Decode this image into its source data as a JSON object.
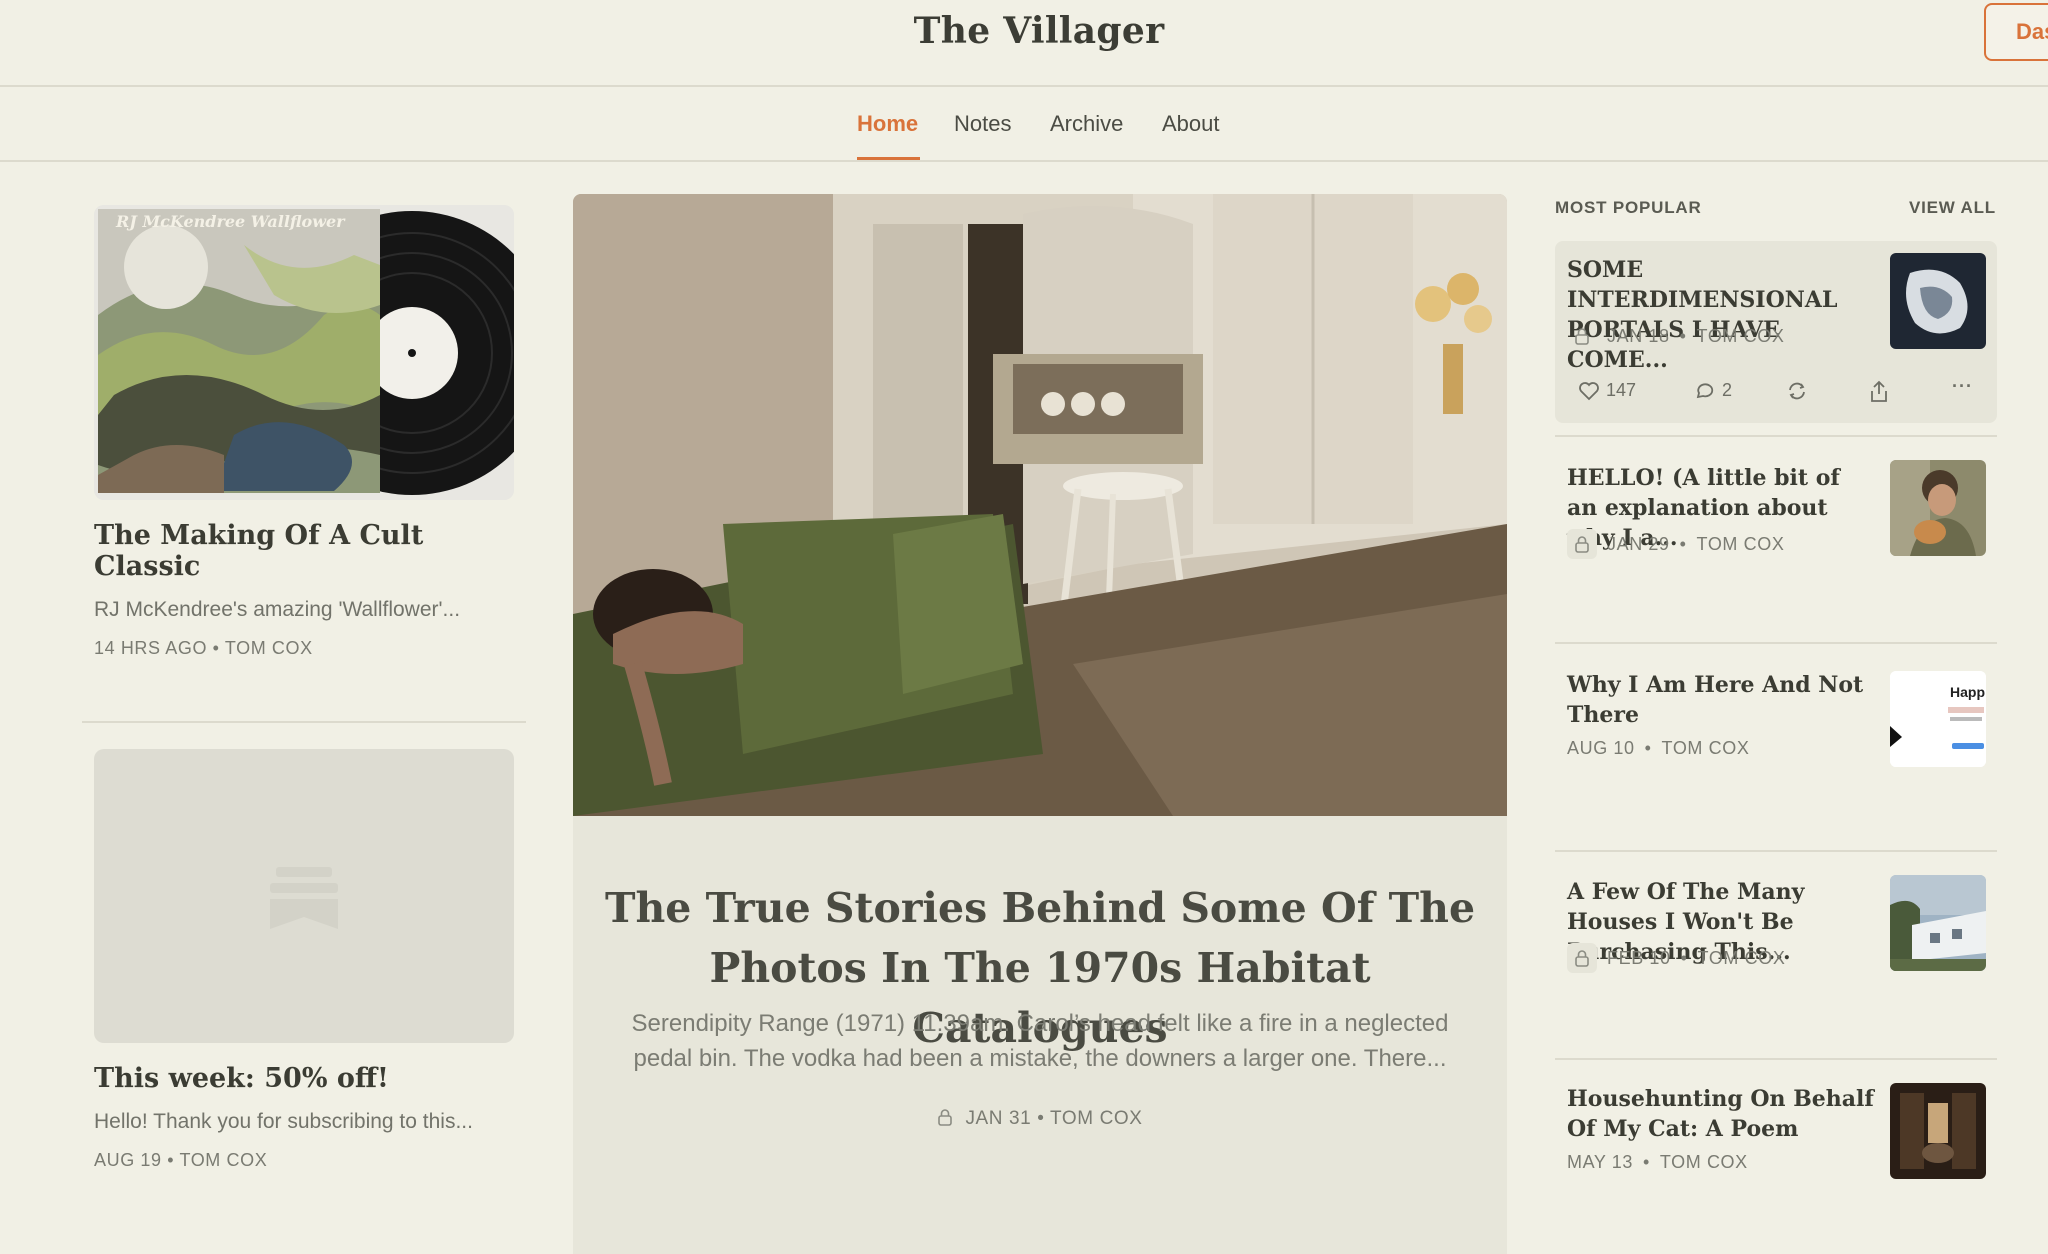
{
  "header": {
    "site_title": "The Villager",
    "dashboard_label": "Das"
  },
  "nav": {
    "home": "Home",
    "notes": "Notes",
    "archive": "Archive",
    "about": "About",
    "active": "Home"
  },
  "left": {
    "album_top_text": "RJ McKendree   Wallflower",
    "post1": {
      "title": "The Making Of A Cult Classic",
      "subtitle": "RJ McKendree's amazing 'Wallflower'...",
      "date": "14 HRS AGO",
      "author": "TOM COX"
    },
    "post2": {
      "title": "This week: 50% off!",
      "subtitle": "Hello! Thank you for subscribing to this...",
      "date": "AUG 19",
      "author": "TOM COX"
    }
  },
  "hero": {
    "title": "The True Stories Behind Some Of The Photos In The 1970s Habitat Catalogues",
    "subtitle": "Serendipity Range (1971) 11.39am. Carol’s head felt like a fire in a neglected pedal bin. The vodka had been a mistake, the downers a larger one. There...",
    "date": "JAN 31",
    "author": "TOM COX",
    "locked": true
  },
  "most_popular": {
    "heading": "MOST POPULAR",
    "view_all": "VIEW ALL",
    "items": [
      {
        "title": "SOME INTERDIMENSIONAL PORTALS I HAVE COME...",
        "date": "JAN 18",
        "author": "TOM COX",
        "locked": true,
        "likes": "147",
        "comments": "2"
      },
      {
        "title": "HELLO! (A little bit of an explanation about why I a...",
        "date": "JAN 29",
        "author": "TOM COX",
        "locked": true
      },
      {
        "title": "Why I Am Here And Not There",
        "date": "AUG 10",
        "author": "TOM COX",
        "locked": false,
        "thumb_text": "Happ"
      },
      {
        "title": "A Few Of The Many Houses I Won't Be Purchasing This...",
        "date": "FEB 10",
        "author": "TOM COX",
        "locked": true
      },
      {
        "title": "Househunting On Behalf Of My Cat: A Poem",
        "date": "MAY 13",
        "author": "TOM COX",
        "locked": false
      }
    ]
  },
  "colors": {
    "background": "#f1f0e5",
    "accent": "#d9733a",
    "text": "#36382f",
    "muted": "#7a7b72"
  },
  "icons": [
    "lock-icon",
    "heart-icon",
    "comment-icon",
    "restack-icon",
    "share-icon",
    "more-icon",
    "image-placeholder-icon"
  ]
}
